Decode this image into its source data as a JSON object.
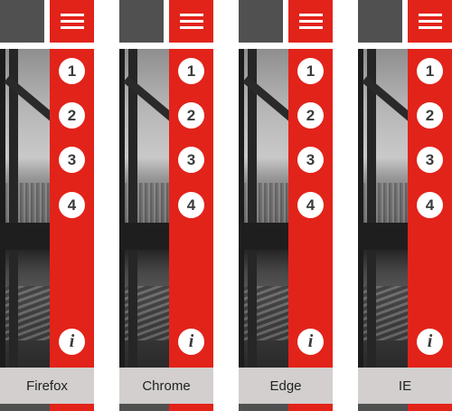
{
  "panels": [
    {
      "browser_label": "Firefox"
    },
    {
      "browser_label": "Chrome"
    },
    {
      "browser_label": "Edge"
    },
    {
      "browser_label": "IE"
    }
  ],
  "sidebar_items": [
    "1",
    "2",
    "3",
    "4"
  ],
  "info_label": "i",
  "icons": {
    "menu": "hamburger-menu-icon",
    "info": "info-icon"
  },
  "colors": {
    "accent": "#e2231a",
    "dark": "#505050",
    "label_bg": "#d3cfcf"
  }
}
